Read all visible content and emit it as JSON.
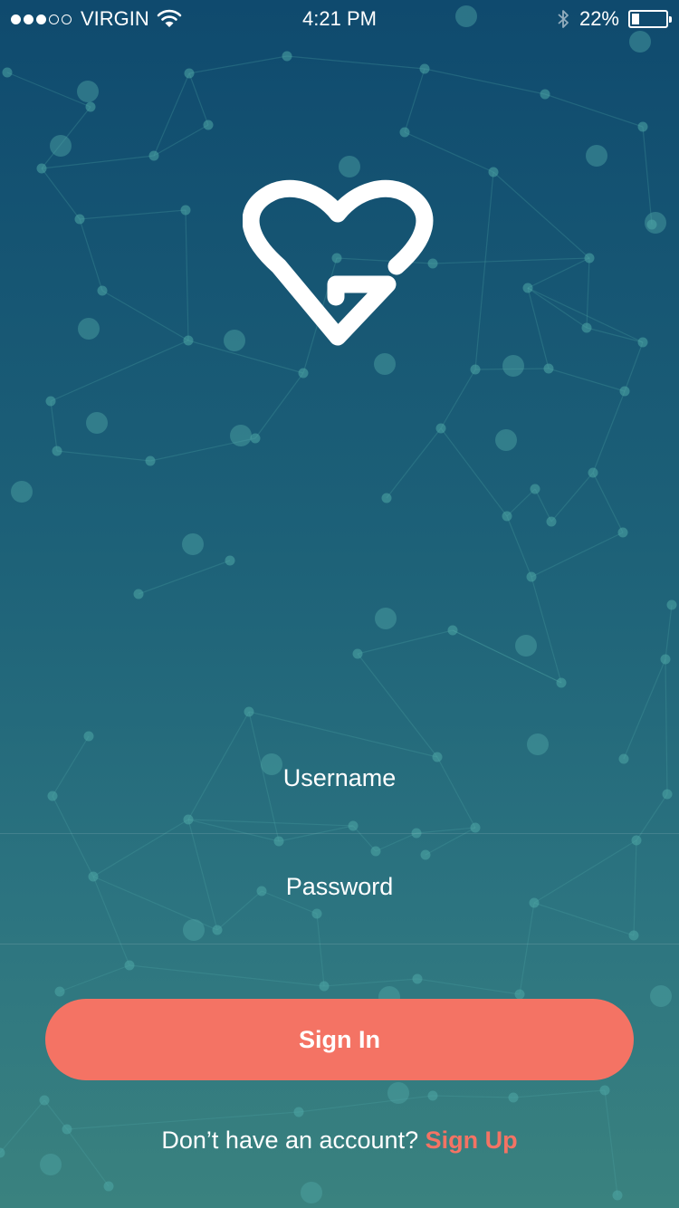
{
  "status_bar": {
    "carrier": "VIRGIN",
    "time": "4:21 PM",
    "battery": "22%",
    "battery_level": 0.22,
    "signal_bars_filled": 3,
    "signal_bars_total": 5
  },
  "login": {
    "username_placeholder": "Username",
    "password_placeholder": "Password",
    "signin_label": "Sign In",
    "no_account_text": "Don’t have an account?",
    "signup_label": "Sign Up"
  },
  "icons": {
    "logo": "heart-g-logo",
    "wifi": "wifi-icon",
    "bluetooth": "bluetooth-icon",
    "battery": "battery-icon"
  },
  "colors": {
    "accent": "#f47364",
    "background_top": "#0f4a6e",
    "background_bottom": "#3a827f",
    "network": "#4fa7a6"
  }
}
